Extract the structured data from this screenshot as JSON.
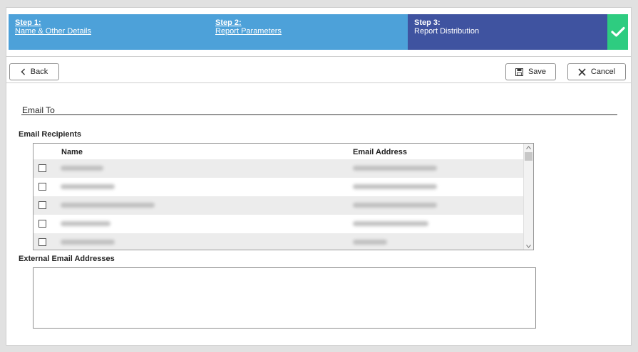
{
  "wizard": {
    "steps": [
      {
        "title": "Step 1:",
        "subtitle": "Name & Other Details"
      },
      {
        "title": "Step 2:",
        "subtitle": "Report Parameters"
      },
      {
        "title": "Step 3:",
        "subtitle": "Report Distribution"
      }
    ],
    "complete_icon": "checkmark-icon"
  },
  "toolbar": {
    "back_label": "Back",
    "save_label": "Save",
    "cancel_label": "Cancel",
    "back_icon": "chevron-left-icon",
    "save_icon": "floppy-disk-icon",
    "cancel_icon": "close-icon"
  },
  "email_to": {
    "section_title": "Email To",
    "recipients_label": "Email Recipients",
    "columns": {
      "name": "Name",
      "email": "Email Address"
    },
    "external_label": "External Email Addresses",
    "external_value": ""
  },
  "colors": {
    "step_complete": "#4da1d9",
    "step_current": "#3f53a0",
    "success": "#2ecc80"
  }
}
